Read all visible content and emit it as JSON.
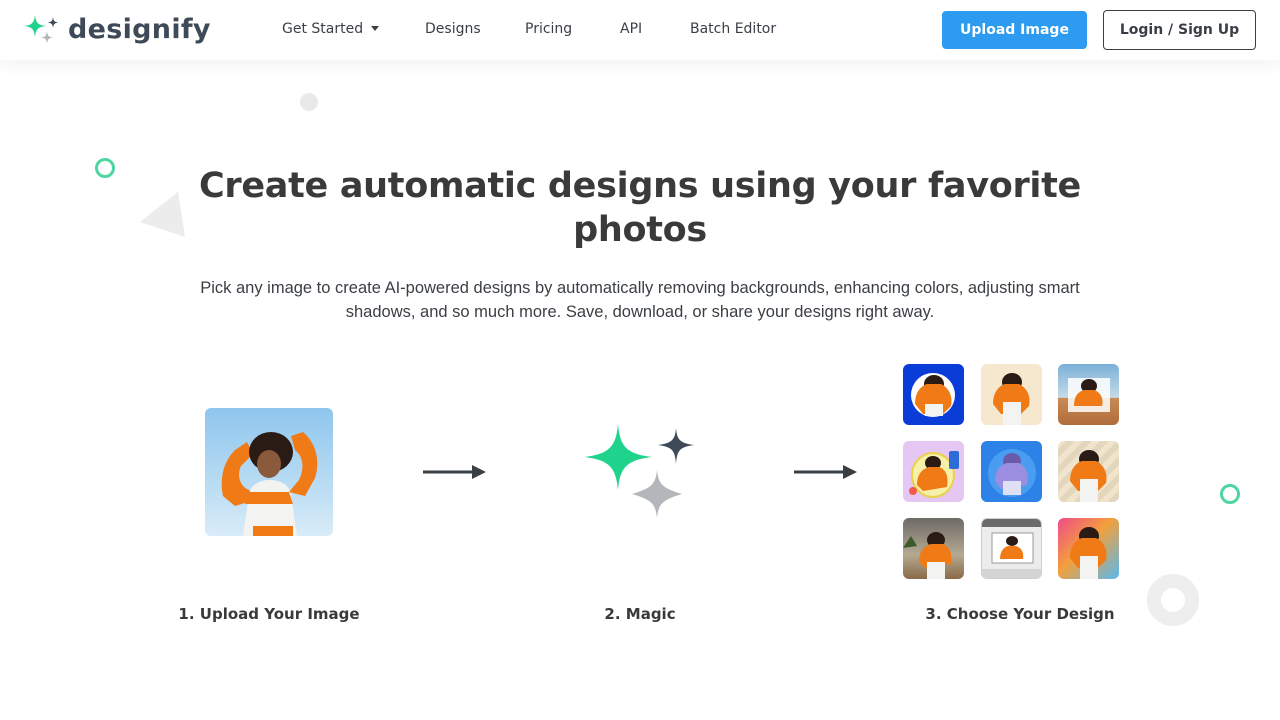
{
  "brand": {
    "name": "designify"
  },
  "nav": {
    "items": [
      {
        "label": "Get Started"
      },
      {
        "label": "Designs"
      },
      {
        "label": "Pricing"
      },
      {
        "label": "API"
      },
      {
        "label": "Batch Editor"
      }
    ],
    "upload_label": "Upload Image",
    "login_label": "Login / Sign Up"
  },
  "hero": {
    "title": "Create automatic designs using your favorite photos",
    "subtitle": "Pick any image to create AI-powered designs by automatically removing backgrounds, enhancing colors, adjusting smart shadows, and so much more. Save, download, or share your designs right away."
  },
  "steps": [
    {
      "label": "1. Upload Your Image"
    },
    {
      "label": "2. Magic"
    },
    {
      "label": "3. Choose Your Design"
    }
  ],
  "colors": {
    "accent_green": "#20d38c",
    "accent_blue": "#2d9bf0",
    "dark": "#3e4a57",
    "grey_sparkle": "#b3b6ba"
  },
  "icons": [
    "sparkle-logo-icon",
    "chevron-down-icon",
    "arrow-right-icon",
    "magic-sparkle-icon"
  ]
}
